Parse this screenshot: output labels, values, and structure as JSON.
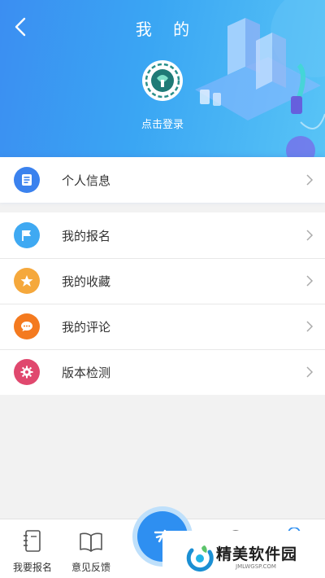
{
  "header": {
    "title": "我 的",
    "login_label": "点击登录",
    "back_icon": "chevron-left-icon"
  },
  "menu": {
    "profile": {
      "label": "个人信息",
      "icon": "document-icon",
      "color": "#3b82ee"
    },
    "items": [
      {
        "label": "我的报名",
        "icon": "flag-icon",
        "color": "#3fa9f2"
      },
      {
        "label": "我的收藏",
        "icon": "star-icon",
        "color": "#f5a83c"
      },
      {
        "label": "我的评论",
        "icon": "chat-bubble-icon",
        "color": "#f47a1f"
      },
      {
        "label": "版本检测",
        "icon": "gear-icon",
        "color": "#e0486e"
      }
    ]
  },
  "tabbar": {
    "tabs": [
      {
        "label": "我要报名",
        "icon": "notebook-icon"
      },
      {
        "label": "意见反馈",
        "icon": "book-icon"
      }
    ],
    "center_icon": "pen-icon"
  },
  "watermark": {
    "text": "精美软件园",
    "sub": "JMLWGSP.COM"
  },
  "colors": {
    "header_start": "#3b8ef2",
    "header_end": "#58c4f6",
    "accent": "#2e8ff1"
  }
}
